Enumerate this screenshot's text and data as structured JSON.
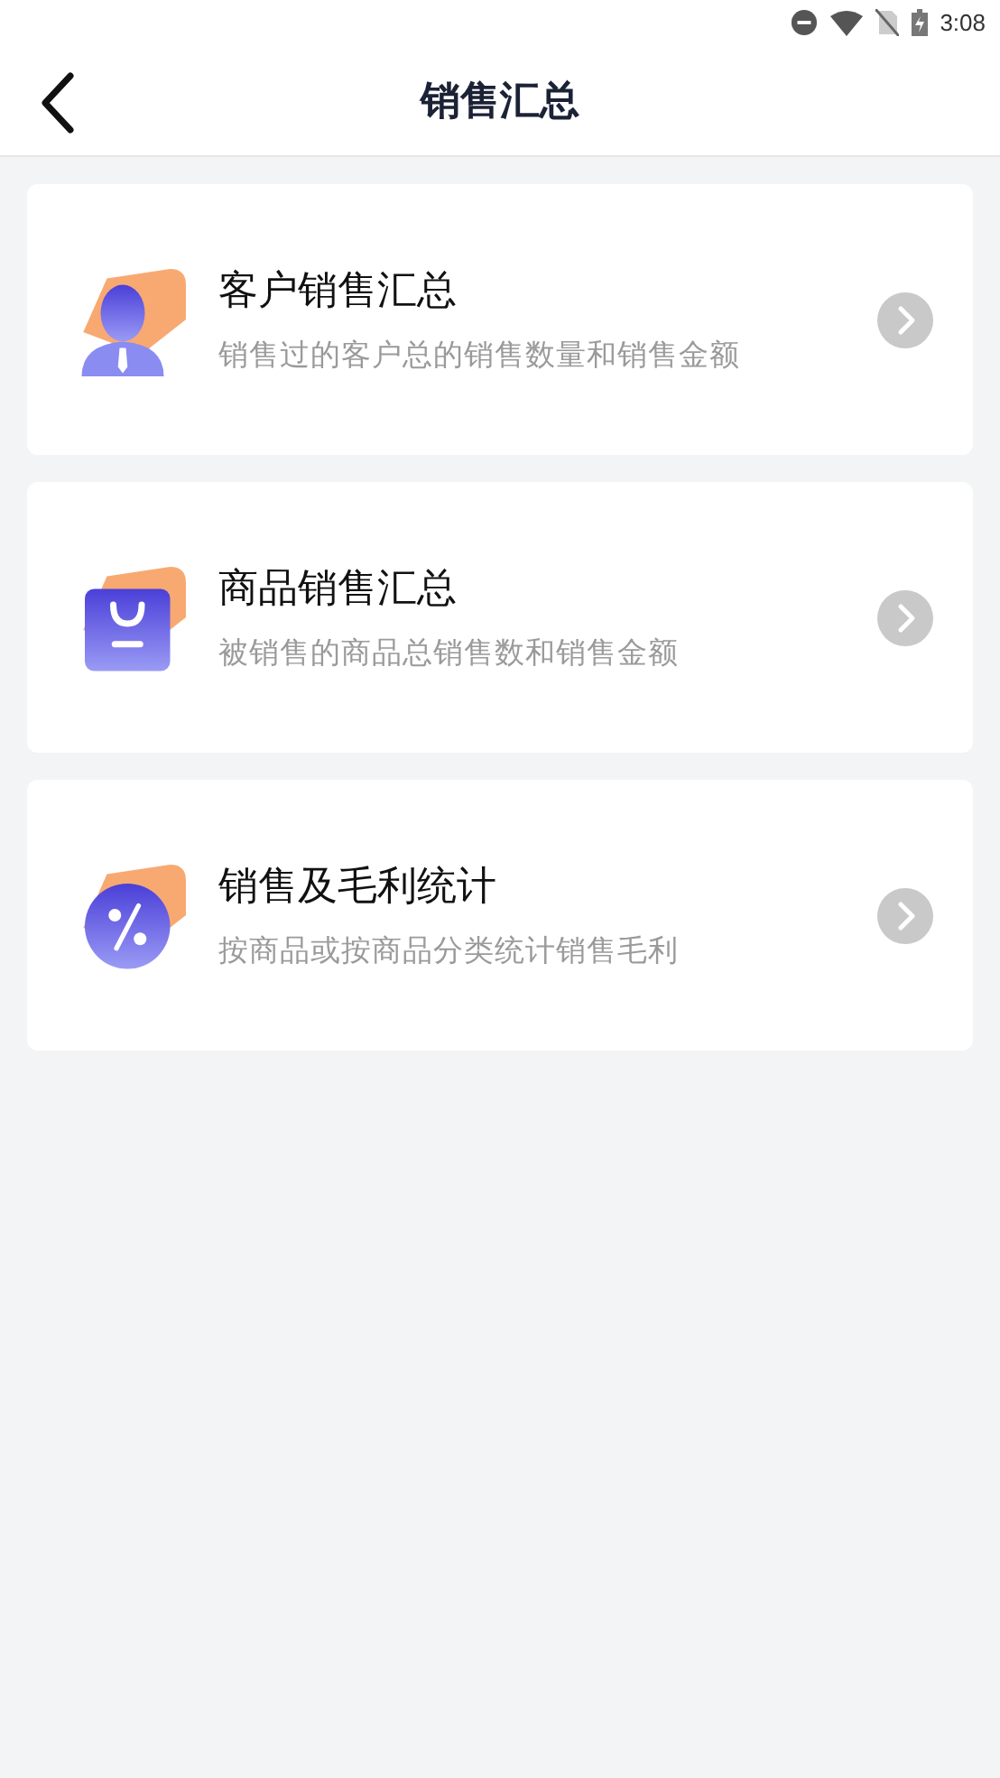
{
  "status_bar": {
    "time": "3:08"
  },
  "header": {
    "title": "销售汇总"
  },
  "items": [
    {
      "title": "客户销售汇总",
      "subtitle": "销售过的客户总的销售数量和销售金额"
    },
    {
      "title": "商品销售汇总",
      "subtitle": "被销售的商品总销售数和销售金额"
    },
    {
      "title": "销售及毛利统计",
      "subtitle": "按商品或按商品分类统计销售毛利"
    }
  ]
}
